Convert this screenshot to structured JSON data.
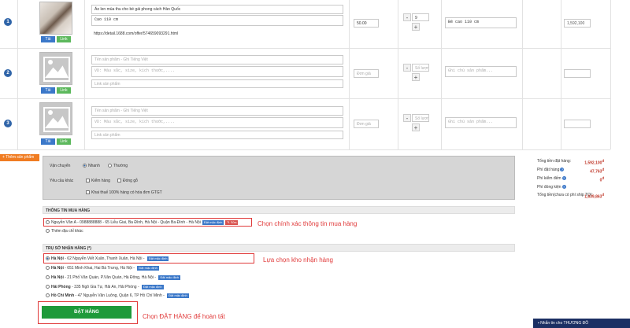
{
  "products": [
    {
      "index": "1",
      "tai": "Tải",
      "link": "Link",
      "name": "Áo len mùa thu cho bé gái phong cách Hàn Quốc",
      "desc": "Cao 110 cm",
      "url": "https://detail.1688.com/offer/574659093291.html",
      "price": "50.00",
      "qty": "9",
      "note": "Bé cao 110 cm",
      "total": "1,592,100"
    },
    {
      "index": "2",
      "tai": "Tải",
      "link": "Link",
      "name_placeholder": "Tên sản phẩm - Ghi Tiếng Việt",
      "desc_placeholder": "VD: Màu sắc, size, kích thước,....",
      "url_placeholder": "Link sản phẩm",
      "price_placeholder": "Đơn giá",
      "qty_placeholder": "Số lượn",
      "note_placeholder": "Ghi chú sản phẩm..."
    },
    {
      "index": "3",
      "tai": "Tải",
      "link": "Link",
      "name_placeholder": "Tên sản phẩm - Ghi Tiếng Việt",
      "desc_placeholder": "VD: Màu sắc, size, kích thước,....",
      "url_placeholder": "Link sản phẩm",
      "price_placeholder": "Đơn giá",
      "qty_placeholder": "Số lượn",
      "note_placeholder": "Ghi chú sản phẩm..."
    }
  ],
  "stepper": {
    "minus": "-",
    "plus": "+"
  },
  "add_product": "+ Thêm sản phẩm",
  "options": {
    "shipping_label": "Vận chuyển",
    "shipping_fast": "Nhanh",
    "shipping_normal": "Thường",
    "other_label": "Yêu cầu khác",
    "inspect": "Kiểm hàng",
    "wood": "Đóng gỗ",
    "invoice": "Khai thuế 100% hàng có hóa đơn GTGT"
  },
  "buyer": {
    "header": "THÔNG TIN MUA HÀNG",
    "address": "Nguyễn Văn A - 0988888888 - 65 Liễu Giai, Ba Đình, Hà Nội - Quận Ba Đình - Hà Nội",
    "default_tag": "Đặt mặc định",
    "edit_tag": "✎ Sửa",
    "add_new": "Thêm địa chỉ khác",
    "annotation": "Chọn chính xác thông tin mua hàng"
  },
  "warehouse": {
    "header": "TRỤ SỞ NHẬN HÀNG (*)",
    "items": [
      {
        "city": "Hà Nội",
        "addr": " - 62 Nguyễn Viết Xuân, Thanh Xuân, Hà Nội - ",
        "tag": "Đặt mặc định"
      },
      {
        "city": "Hà Nội",
        "addr": " - 651 Minh Khai, Hai Bà Trưng, Hà Nội - ",
        "tag": "Đặt mặc định"
      },
      {
        "city": "Hà Nội",
        "addr": " - 21 Phố Văn Quán, P.Văn Quán, Hà Đông, Hà Nội - ",
        "tag": "Đặt mặc định"
      },
      {
        "city": "Hải Phòng",
        "addr": " - 335 Ngô Gia Tự, Hải An, Hải Phòng - ",
        "tag": "Đặt mặc định"
      },
      {
        "city": "Hồ Chí Minh",
        "addr": " - 47 Nguyễn Văn Luông, Quận 6, TP Hồ Chí Minh - ",
        "tag": "Đặt mặc định"
      }
    ],
    "annotation": "Lựa chọn kho nhận hàng"
  },
  "order": {
    "button": "ĐẶT HÀNG",
    "annotation": "Chọn ĐẶT HÀNG để hoàn tất"
  },
  "summary": {
    "total_label": "Tổng tiền đặt hàng:",
    "total_val": "1,592,100",
    "fee_label": "Phí đặt hàng",
    "fee_val": "47,763",
    "inspect_label": "Phí kiểm đếm",
    "inspect_val": "0",
    "wood_label": "Phí đóng kiện",
    "grand_label": "Tổng tiền(chưa có phí ship TQ):",
    "grand_val": "1,639,863",
    "currency": "đ"
  },
  "chat": {
    "label": "Nhắn tin cho THƯƠNG ĐÔ"
  },
  "colors": {
    "accent": "#2f64a8",
    "annotation": "#e03a3a",
    "order_button": "#1e9a3a",
    "add_product": "#f07c22"
  }
}
